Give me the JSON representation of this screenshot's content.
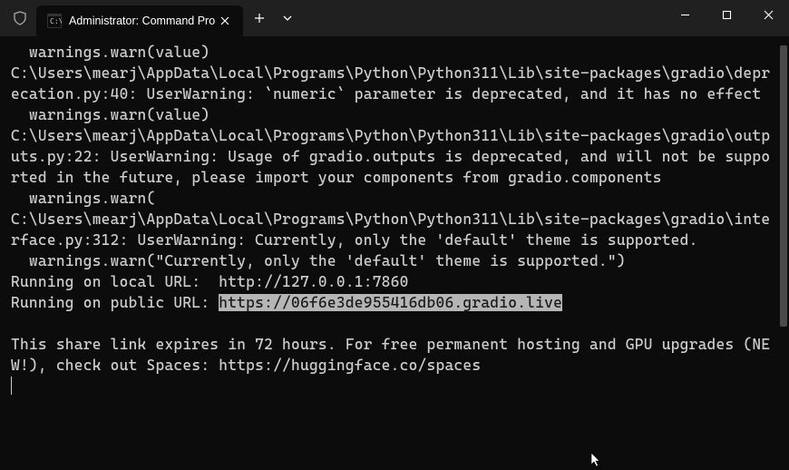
{
  "titlebar": {
    "tab_title": "Administrator: Command Pro"
  },
  "terminal": {
    "lines": [
      "  warnings.warn(value)",
      "C:\\Users\\mearj\\AppData\\Local\\Programs\\Python\\Python311\\Lib\\site-packages\\gradio\\deprecation.py:40: UserWarning: `numeric` parameter is deprecated, and it has no effect",
      "  warnings.warn(value)",
      "C:\\Users\\mearj\\AppData\\Local\\Programs\\Python\\Python311\\Lib\\site-packages\\gradio\\outputs.py:22: UserWarning: Usage of gradio.outputs is deprecated, and will not be supported in the future, please import your components from gradio.components",
      "  warnings.warn(",
      "C:\\Users\\mearj\\AppData\\Local\\Programs\\Python\\Python311\\Lib\\site-packages\\gradio\\interface.py:312: UserWarning: Currently, only the 'default' theme is supported.",
      "  warnings.warn(\"Currently, only the 'default' theme is supported.\")",
      "Running on local URL:  http://127.0.0.1:7860"
    ],
    "public_url_prefix": "Running on public URL: ",
    "public_url": "https://06f6e3de955416db06.gradio.live",
    "share_msg": "This share link expires in 72 hours. For free permanent hosting and GPU upgrades (NEW!), check out Spaces: https://huggingface.co/spaces"
  }
}
